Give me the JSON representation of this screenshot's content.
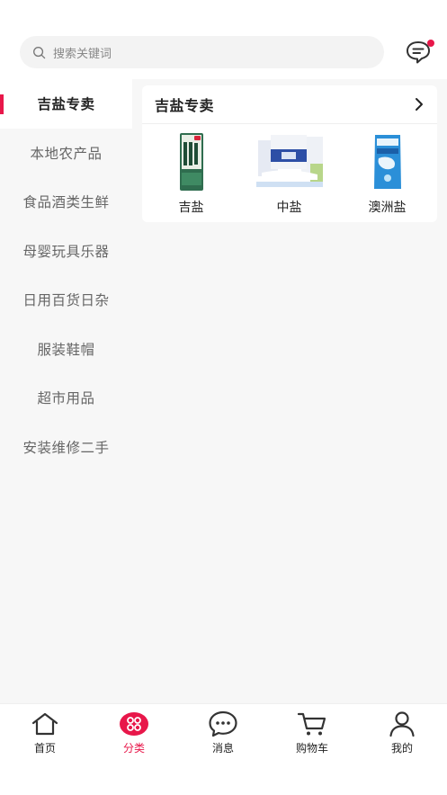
{
  "search": {
    "placeholder": "搜索关键词"
  },
  "colors": {
    "accent": "#e8174a",
    "sidebar_bg": "#f7f7f7"
  },
  "sidebar": {
    "items": [
      {
        "label": "吉盐专卖",
        "active": true
      },
      {
        "label": "本地农产品"
      },
      {
        "label": "食品酒类生鲜"
      },
      {
        "label": "母婴玩具乐器"
      },
      {
        "label": "日用百货日杂"
      },
      {
        "label": "服装鞋帽"
      },
      {
        "label": "超市用品"
      },
      {
        "label": "安装维修二手"
      }
    ]
  },
  "category_card": {
    "title": "吉盐专卖",
    "more_icon": "chevron-right-icon",
    "products": [
      {
        "name": "吉盐"
      },
      {
        "name": "中盐"
      },
      {
        "name": "澳洲盐"
      }
    ]
  },
  "tabbar": {
    "tabs": [
      {
        "label": "首页",
        "icon": "home-icon"
      },
      {
        "label": "分类",
        "icon": "category-icon",
        "active": true
      },
      {
        "label": "消息",
        "icon": "message-icon"
      },
      {
        "label": "购物车",
        "icon": "cart-icon"
      },
      {
        "label": "我的",
        "icon": "user-icon"
      }
    ]
  }
}
